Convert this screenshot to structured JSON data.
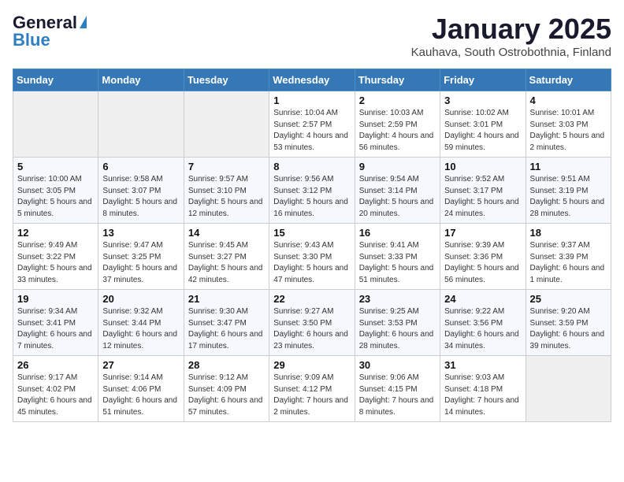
{
  "header": {
    "logo_general": "General",
    "logo_blue": "Blue",
    "month": "January 2025",
    "location": "Kauhava, South Ostrobothnia, Finland"
  },
  "days_of_week": [
    "Sunday",
    "Monday",
    "Tuesday",
    "Wednesday",
    "Thursday",
    "Friday",
    "Saturday"
  ],
  "weeks": [
    [
      {
        "day": "",
        "info": ""
      },
      {
        "day": "",
        "info": ""
      },
      {
        "day": "",
        "info": ""
      },
      {
        "day": "1",
        "info": "Sunrise: 10:04 AM\nSunset: 2:57 PM\nDaylight: 4 hours and 53 minutes."
      },
      {
        "day": "2",
        "info": "Sunrise: 10:03 AM\nSunset: 2:59 PM\nDaylight: 4 hours and 56 minutes."
      },
      {
        "day": "3",
        "info": "Sunrise: 10:02 AM\nSunset: 3:01 PM\nDaylight: 4 hours and 59 minutes."
      },
      {
        "day": "4",
        "info": "Sunrise: 10:01 AM\nSunset: 3:03 PM\nDaylight: 5 hours and 2 minutes."
      }
    ],
    [
      {
        "day": "5",
        "info": "Sunrise: 10:00 AM\nSunset: 3:05 PM\nDaylight: 5 hours and 5 minutes."
      },
      {
        "day": "6",
        "info": "Sunrise: 9:58 AM\nSunset: 3:07 PM\nDaylight: 5 hours and 8 minutes."
      },
      {
        "day": "7",
        "info": "Sunrise: 9:57 AM\nSunset: 3:10 PM\nDaylight: 5 hours and 12 minutes."
      },
      {
        "day": "8",
        "info": "Sunrise: 9:56 AM\nSunset: 3:12 PM\nDaylight: 5 hours and 16 minutes."
      },
      {
        "day": "9",
        "info": "Sunrise: 9:54 AM\nSunset: 3:14 PM\nDaylight: 5 hours and 20 minutes."
      },
      {
        "day": "10",
        "info": "Sunrise: 9:52 AM\nSunset: 3:17 PM\nDaylight: 5 hours and 24 minutes."
      },
      {
        "day": "11",
        "info": "Sunrise: 9:51 AM\nSunset: 3:19 PM\nDaylight: 5 hours and 28 minutes."
      }
    ],
    [
      {
        "day": "12",
        "info": "Sunrise: 9:49 AM\nSunset: 3:22 PM\nDaylight: 5 hours and 33 minutes."
      },
      {
        "day": "13",
        "info": "Sunrise: 9:47 AM\nSunset: 3:25 PM\nDaylight: 5 hours and 37 minutes."
      },
      {
        "day": "14",
        "info": "Sunrise: 9:45 AM\nSunset: 3:27 PM\nDaylight: 5 hours and 42 minutes."
      },
      {
        "day": "15",
        "info": "Sunrise: 9:43 AM\nSunset: 3:30 PM\nDaylight: 5 hours and 47 minutes."
      },
      {
        "day": "16",
        "info": "Sunrise: 9:41 AM\nSunset: 3:33 PM\nDaylight: 5 hours and 51 minutes."
      },
      {
        "day": "17",
        "info": "Sunrise: 9:39 AM\nSunset: 3:36 PM\nDaylight: 5 hours and 56 minutes."
      },
      {
        "day": "18",
        "info": "Sunrise: 9:37 AM\nSunset: 3:39 PM\nDaylight: 6 hours and 1 minute."
      }
    ],
    [
      {
        "day": "19",
        "info": "Sunrise: 9:34 AM\nSunset: 3:41 PM\nDaylight: 6 hours and 7 minutes."
      },
      {
        "day": "20",
        "info": "Sunrise: 9:32 AM\nSunset: 3:44 PM\nDaylight: 6 hours and 12 minutes."
      },
      {
        "day": "21",
        "info": "Sunrise: 9:30 AM\nSunset: 3:47 PM\nDaylight: 6 hours and 17 minutes."
      },
      {
        "day": "22",
        "info": "Sunrise: 9:27 AM\nSunset: 3:50 PM\nDaylight: 6 hours and 23 minutes."
      },
      {
        "day": "23",
        "info": "Sunrise: 9:25 AM\nSunset: 3:53 PM\nDaylight: 6 hours and 28 minutes."
      },
      {
        "day": "24",
        "info": "Sunrise: 9:22 AM\nSunset: 3:56 PM\nDaylight: 6 hours and 34 minutes."
      },
      {
        "day": "25",
        "info": "Sunrise: 9:20 AM\nSunset: 3:59 PM\nDaylight: 6 hours and 39 minutes."
      }
    ],
    [
      {
        "day": "26",
        "info": "Sunrise: 9:17 AM\nSunset: 4:02 PM\nDaylight: 6 hours and 45 minutes."
      },
      {
        "day": "27",
        "info": "Sunrise: 9:14 AM\nSunset: 4:06 PM\nDaylight: 6 hours and 51 minutes."
      },
      {
        "day": "28",
        "info": "Sunrise: 9:12 AM\nSunset: 4:09 PM\nDaylight: 6 hours and 57 minutes."
      },
      {
        "day": "29",
        "info": "Sunrise: 9:09 AM\nSunset: 4:12 PM\nDaylight: 7 hours and 2 minutes."
      },
      {
        "day": "30",
        "info": "Sunrise: 9:06 AM\nSunset: 4:15 PM\nDaylight: 7 hours and 8 minutes."
      },
      {
        "day": "31",
        "info": "Sunrise: 9:03 AM\nSunset: 4:18 PM\nDaylight: 7 hours and 14 minutes."
      },
      {
        "day": "",
        "info": ""
      }
    ]
  ]
}
